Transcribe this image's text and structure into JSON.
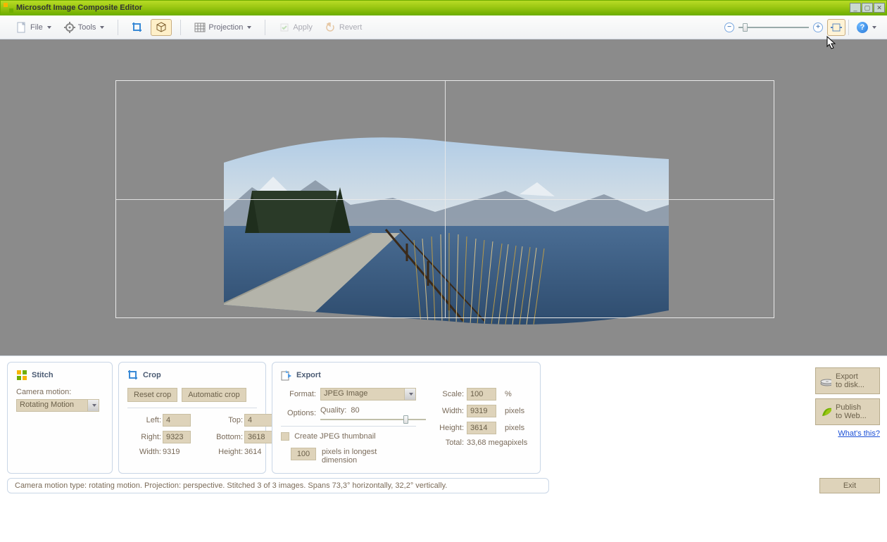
{
  "window": {
    "title": "Microsoft Image Composite Editor"
  },
  "toolbar": {
    "file": "File",
    "tools": "Tools",
    "projection": "Projection",
    "apply": "Apply",
    "revert": "Revert"
  },
  "stitch": {
    "title": "Stitch",
    "camera_motion_label": "Camera motion:",
    "camera_motion_value": "Rotating Motion"
  },
  "crop": {
    "title": "Crop",
    "reset": "Reset crop",
    "auto": "Automatic crop",
    "left_label": "Left:",
    "left_val": "4",
    "top_label": "Top:",
    "top_val": "4",
    "right_label": "Right:",
    "right_val": "9323",
    "bottom_label": "Bottom:",
    "bottom_val": "3618",
    "width_label": "Width:",
    "width_val": "9319",
    "height_label": "Height:",
    "height_val": "3614"
  },
  "export": {
    "title": "Export",
    "format_label": "Format:",
    "format_value": "JPEG Image",
    "options_label": "Options:",
    "quality_label": "Quality:",
    "quality_value": "80",
    "scale_label": "Scale:",
    "scale_value": "100",
    "percent": "%",
    "width_label": "Width:",
    "width_value": "9319",
    "height_label": "Height:",
    "height_value": "3614",
    "pixels": "pixels",
    "total_label": "Total:",
    "total_value": "33,68 megapixels",
    "thumb_check": "Create JPEG thumbnail",
    "thumb_px": "100",
    "thumb_desc1": "pixels in longest",
    "thumb_desc2": "dimension"
  },
  "right": {
    "export1": "Export",
    "export2": "to disk...",
    "publish1": "Publish",
    "publish2": "to Web...",
    "whats": "What's this?"
  },
  "status": "Camera motion type: rotating motion. Projection: perspective. Stitched 3 of 3 images. Spans 73,3° horizontally, 32,2° vertically.",
  "exit": "Exit"
}
